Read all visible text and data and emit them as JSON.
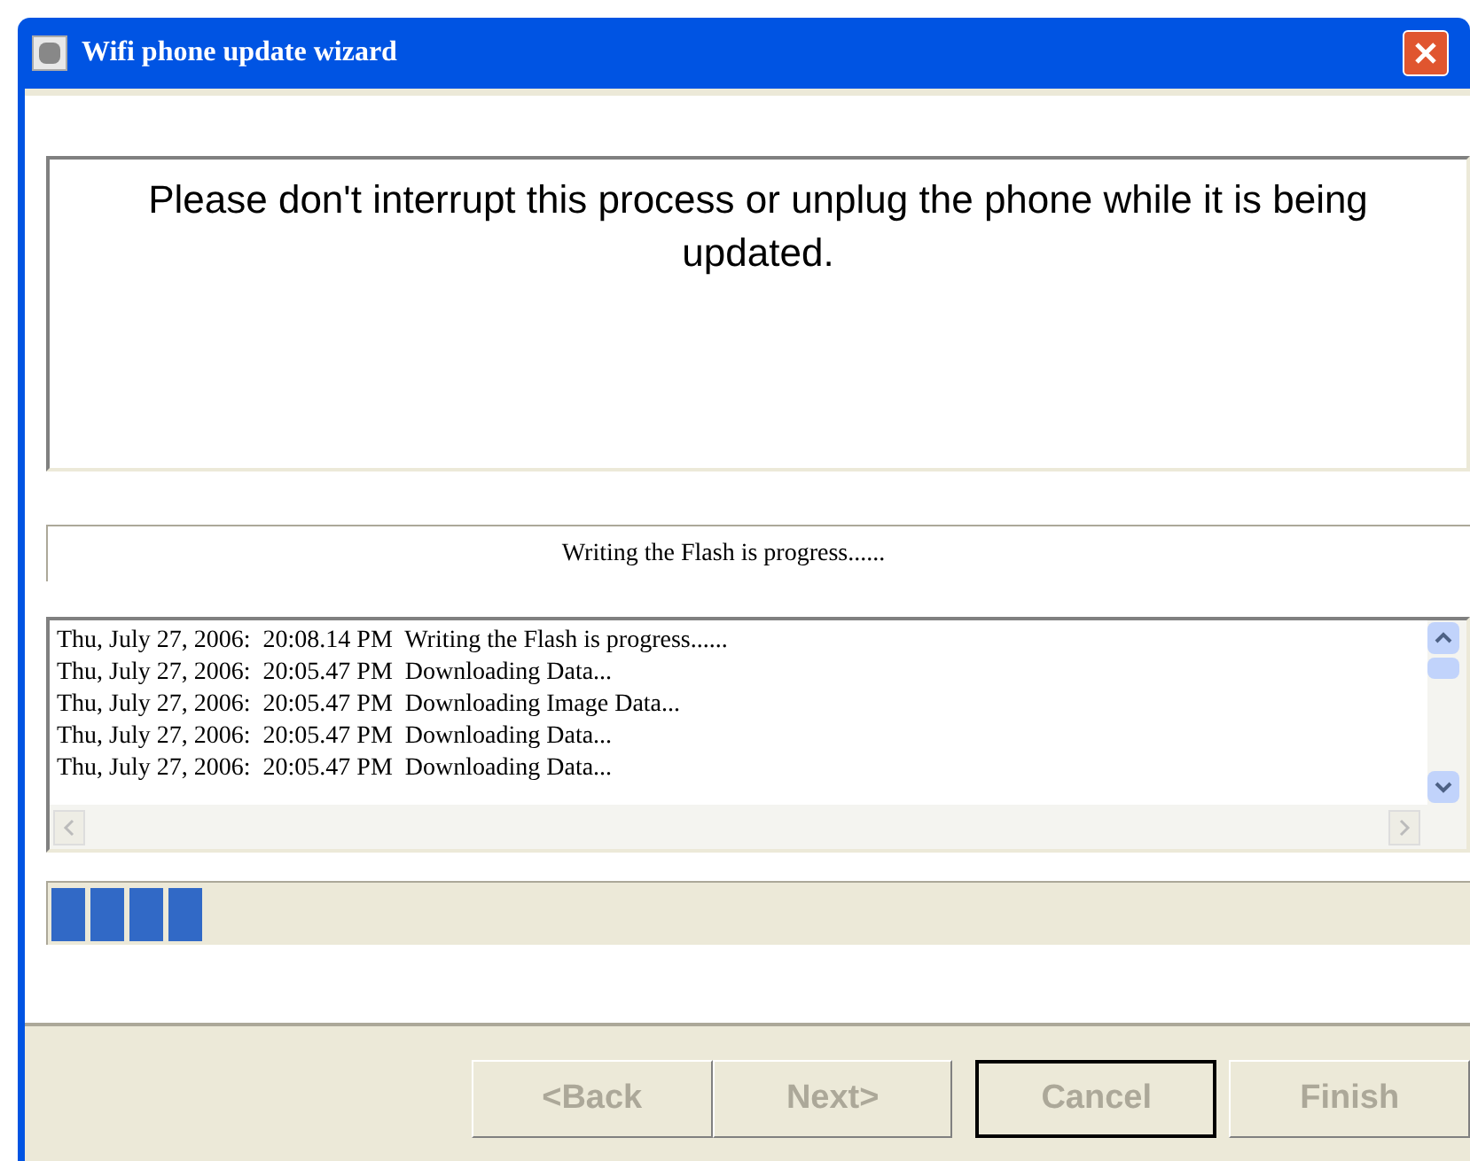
{
  "window": {
    "title": "Wifi phone update wizard"
  },
  "message": "Please don't interrupt this process or unplug the phone while it is being updated.",
  "status": "Writing the Flash is progress......",
  "log": [
    {
      "date": "Thu, July 27, 2006:",
      "time": "20:08.14 PM",
      "text": "Writing the Flash is progress......"
    },
    {
      "date": "Thu, July 27, 2006:",
      "time": "20:05.47 PM",
      "text": "Downloading Data..."
    },
    {
      "date": "Thu, July 27, 2006:",
      "time": "20:05.47 PM",
      "text": "Downloading Image Data..."
    },
    {
      "date": "Thu, July 27, 2006:",
      "time": "20:05.47 PM",
      "text": "Downloading Data..."
    },
    {
      "date": "Thu, July 27, 2006:",
      "time": "20:05.47 PM",
      "text": "Downloading Data..."
    }
  ],
  "progress": {
    "level": 0.11
  },
  "buttons": [
    {
      "label": "<Back",
      "disabled": true,
      "default": false
    },
    {
      "label": "Next>",
      "disabled": true,
      "default": false
    },
    {
      "label": "Cancel",
      "disabled": true,
      "default": true
    },
    {
      "label": "Finish",
      "disabled": true,
      "default": false
    }
  ]
}
